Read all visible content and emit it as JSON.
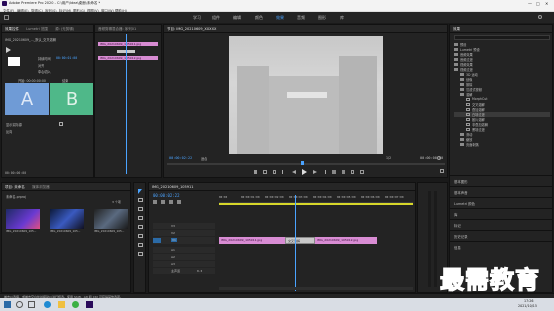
{
  "app": {
    "title": "Adobe Premiere Pro 2020 - C:\\用户\\Idea\\桌面\\未命名 *",
    "window_controls": [
      "—",
      "□",
      "✕"
    ],
    "menu": [
      "文件(F)",
      "编辑(E)",
      "剪辑(C)",
      "序列(S)",
      "标记(M)",
      "图形(G)",
      "视图(V)",
      "窗口(W)",
      "帮助(H)"
    ],
    "workspaces": [
      "学习",
      "组件",
      "编辑",
      "颜色",
      "效果",
      "音频",
      "图形",
      "库"
    ],
    "active_workspace": "效果"
  },
  "effect_controls": {
    "tabs": [
      "效果控件",
      "Lumetri 范围",
      "源: (无剪辑)",
      "音频剪辑混合器: 序列01"
    ],
    "clip_label": "IMG_20210609_..._默认_交叉溶解",
    "duration_label": "持续时间",
    "duration_value": "00:00:01:00",
    "alignment_label": "对齐",
    "alignment_value": "中心切入",
    "start_label": "开始: 00:00:00:00",
    "end_label": "结束",
    "thumb_a": "A",
    "thumb_b": "B",
    "show_actual_label": "显示实际源",
    "reverse_label": "反向",
    "timecode": "00:00:00:00"
  },
  "mini_timeline": {
    "clips": [
      "IMG_20210609_105911.jpg",
      "IMG_20210609_105912.jpg"
    ]
  },
  "program": {
    "tab": "节目: IMG_20210609_XXXXX",
    "timecode_left": "00:00:02:22",
    "fit_label": "适合",
    "ratio_label": "1/2",
    "timecode_right": "00:00:00:00"
  },
  "effects": {
    "tab": "效果",
    "items": [
      {
        "label": "预设",
        "level": 0
      },
      {
        "label": "Lumetri 预设",
        "level": 0
      },
      {
        "label": "音频效果",
        "level": 0
      },
      {
        "label": "音频过渡",
        "level": 0
      },
      {
        "label": "视频效果",
        "level": 0
      },
      {
        "label": "视频过渡",
        "level": 0
      },
      {
        "label": "3D 运动",
        "level": 1
      },
      {
        "label": "划像",
        "level": 1
      },
      {
        "label": "擦除",
        "level": 1
      },
      {
        "label": "沉浸式视频",
        "level": 1
      },
      {
        "label": "溶解",
        "level": 1
      },
      {
        "label": "MorphCut",
        "level": 2
      },
      {
        "label": "交叉溶解",
        "level": 2
      },
      {
        "label": "叠加溶解",
        "level": 2
      },
      {
        "label": "白场过渡",
        "level": 2
      },
      {
        "label": "胶片溶解",
        "level": 2
      },
      {
        "label": "非叠加溶解",
        "level": 2
      },
      {
        "label": "黑场过渡",
        "level": 2
      },
      {
        "label": "滑动",
        "level": 1
      },
      {
        "label": "缩放",
        "level": 1
      },
      {
        "label": "页面剥落",
        "level": 1
      }
    ],
    "bottom_items": [
      "基本图形",
      "基本声音",
      "Lumetri 颜色",
      "库",
      "标记",
      "历史记录",
      "信息"
    ]
  },
  "project": {
    "tabs": [
      "项目: 未命名",
      "媒体浏览器"
    ],
    "path": "未命名.prproj",
    "count": "3 个项",
    "items": [
      {
        "name": "IMG_20210609_105...",
        "duration": "5:00"
      },
      {
        "name": "IMG_20210609_105...",
        "duration": "5:00"
      },
      {
        "name": "IMG_20210609_105...",
        "duration": "5:00"
      }
    ]
  },
  "timeline": {
    "tab": "IMG_20210609_105911",
    "timecode": "00:00:02:22",
    "ruler": [
      "00:00",
      "00:00:01:00",
      "00:00:02:00",
      "00:00:03:00",
      "00:00:04:00",
      "00:00:05:00",
      "00:00:06:00",
      "00:00:07:00"
    ],
    "tracks": [
      "V3",
      "V2",
      "V1",
      "A1",
      "A2",
      "A3"
    ],
    "master_label": "主声道",
    "master_value": "0.0",
    "clips": [
      "IMG_20210609_105911.jpg",
      "交叉溶解",
      "IMG_20210609_105912.jpg"
    ]
  },
  "status": "单击以选择，或单击空白处并拖动以进行框选。使用 Shift、Alt 和 Ctrl 可获得其他选项。",
  "watermark": "最需教育",
  "taskbar": {
    "time": "17:26",
    "date": "2021/10/15"
  }
}
